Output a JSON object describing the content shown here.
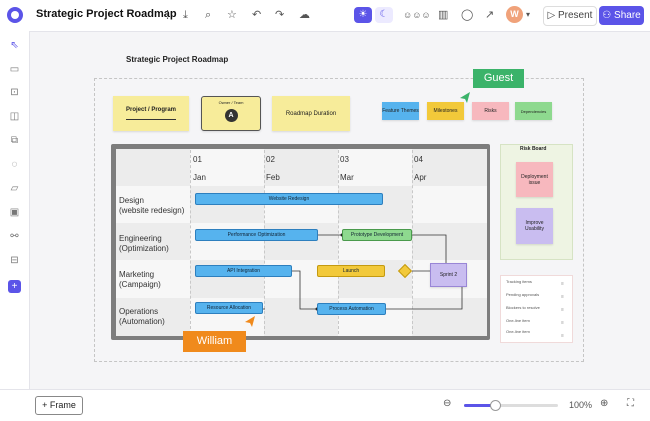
{
  "topbar": {
    "title": "Strategic Project Roadmap",
    "avatar_letter": "W",
    "present_label": "Present",
    "share_label": "Share"
  },
  "canvas": {
    "title": "Strategic Project Roadmap",
    "stickies": {
      "project_program": "Project / Program",
      "owner_team": "Owner / Team",
      "owner_avatar": "A",
      "roadmap_duration": "Roadmap Duration",
      "feature_themes": "Feature Themes",
      "milestones": "Milestones",
      "risks": "Risks",
      "dependencies": "Dependencies"
    },
    "columns": [
      {
        "num": "01",
        "month": "Jan"
      },
      {
        "num": "02",
        "month": "Feb"
      },
      {
        "num": "03",
        "month": "Mar"
      },
      {
        "num": "04",
        "month": "Apr"
      }
    ],
    "rows": [
      {
        "line1": "Design",
        "line2": "(website redesign)"
      },
      {
        "line1": "Engineering",
        "line2": "(Optimization)"
      },
      {
        "line1": "Marketing",
        "line2": "(Campaign)"
      },
      {
        "line1": "Operations",
        "line2": "(Automation)"
      }
    ],
    "bars": {
      "website_redesign": "Website Redesign",
      "performance_optimization": "Performance Optimization",
      "prototype_development": "Prototype Development",
      "api_integration": "API Integration",
      "launch": "Launch",
      "sprint": "Sprint 2",
      "resource_allocation": "Resource Allocation",
      "process_automation": "Process Automation"
    },
    "risk_board": {
      "title": "Risk Board",
      "deployment_issue": "Deployment issue",
      "improve_usability": "Improve Usability"
    },
    "risk_list": [
      "Tracking items",
      "Pending approvals",
      "Blockers to resolve",
      "One-line item",
      "One-line item"
    ],
    "cursors": {
      "guest": "Guest",
      "william": "William"
    }
  },
  "bottombar": {
    "frame_label": "Frame",
    "zoom_level": "100%",
    "zoom_fraction": 0.33
  },
  "colors": {
    "accent": "#5b54e8",
    "guest": "#3bb36a",
    "william": "#f08a1c"
  }
}
